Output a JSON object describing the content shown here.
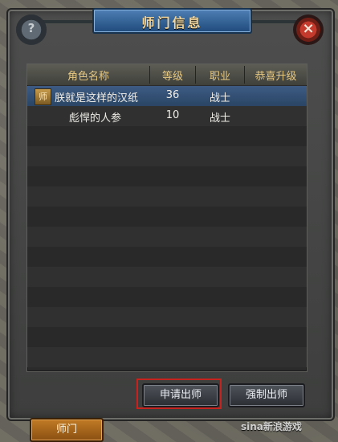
{
  "window": {
    "title": "师门信息",
    "help_glyph": "?",
    "close_glyph": "×"
  },
  "table": {
    "columns": [
      "角色名称",
      "等级",
      "职业",
      "恭喜升级"
    ],
    "rows": [
      {
        "tag": "师",
        "name": "朕就是这样的汉纸",
        "level": "36",
        "job": "战士",
        "congrats": ""
      },
      {
        "tag": "",
        "name": "彪悍的人参",
        "level": "10",
        "job": "战士",
        "congrats": ""
      }
    ]
  },
  "buttons": {
    "apply_graduate": "申请出师",
    "force_graduate": "强制出师"
  },
  "tabs": {
    "master": "师门"
  },
  "watermark": "sina新浪游戏"
}
